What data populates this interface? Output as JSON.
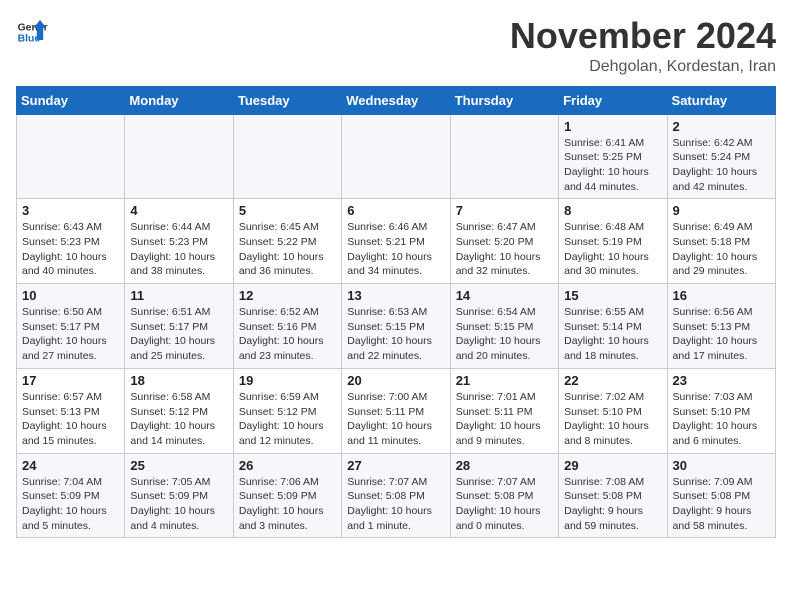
{
  "header": {
    "logo_line1": "General",
    "logo_line2": "Blue",
    "month": "November 2024",
    "location": "Dehgolan, Kordestan, Iran"
  },
  "weekdays": [
    "Sunday",
    "Monday",
    "Tuesday",
    "Wednesday",
    "Thursday",
    "Friday",
    "Saturday"
  ],
  "weeks": [
    [
      {
        "day": "",
        "info": ""
      },
      {
        "day": "",
        "info": ""
      },
      {
        "day": "",
        "info": ""
      },
      {
        "day": "",
        "info": ""
      },
      {
        "day": "",
        "info": ""
      },
      {
        "day": "1",
        "info": "Sunrise: 6:41 AM\nSunset: 5:25 PM\nDaylight: 10 hours and 44 minutes."
      },
      {
        "day": "2",
        "info": "Sunrise: 6:42 AM\nSunset: 5:24 PM\nDaylight: 10 hours and 42 minutes."
      }
    ],
    [
      {
        "day": "3",
        "info": "Sunrise: 6:43 AM\nSunset: 5:23 PM\nDaylight: 10 hours and 40 minutes."
      },
      {
        "day": "4",
        "info": "Sunrise: 6:44 AM\nSunset: 5:23 PM\nDaylight: 10 hours and 38 minutes."
      },
      {
        "day": "5",
        "info": "Sunrise: 6:45 AM\nSunset: 5:22 PM\nDaylight: 10 hours and 36 minutes."
      },
      {
        "day": "6",
        "info": "Sunrise: 6:46 AM\nSunset: 5:21 PM\nDaylight: 10 hours and 34 minutes."
      },
      {
        "day": "7",
        "info": "Sunrise: 6:47 AM\nSunset: 5:20 PM\nDaylight: 10 hours and 32 minutes."
      },
      {
        "day": "8",
        "info": "Sunrise: 6:48 AM\nSunset: 5:19 PM\nDaylight: 10 hours and 30 minutes."
      },
      {
        "day": "9",
        "info": "Sunrise: 6:49 AM\nSunset: 5:18 PM\nDaylight: 10 hours and 29 minutes."
      }
    ],
    [
      {
        "day": "10",
        "info": "Sunrise: 6:50 AM\nSunset: 5:17 PM\nDaylight: 10 hours and 27 minutes."
      },
      {
        "day": "11",
        "info": "Sunrise: 6:51 AM\nSunset: 5:17 PM\nDaylight: 10 hours and 25 minutes."
      },
      {
        "day": "12",
        "info": "Sunrise: 6:52 AM\nSunset: 5:16 PM\nDaylight: 10 hours and 23 minutes."
      },
      {
        "day": "13",
        "info": "Sunrise: 6:53 AM\nSunset: 5:15 PM\nDaylight: 10 hours and 22 minutes."
      },
      {
        "day": "14",
        "info": "Sunrise: 6:54 AM\nSunset: 5:15 PM\nDaylight: 10 hours and 20 minutes."
      },
      {
        "day": "15",
        "info": "Sunrise: 6:55 AM\nSunset: 5:14 PM\nDaylight: 10 hours and 18 minutes."
      },
      {
        "day": "16",
        "info": "Sunrise: 6:56 AM\nSunset: 5:13 PM\nDaylight: 10 hours and 17 minutes."
      }
    ],
    [
      {
        "day": "17",
        "info": "Sunrise: 6:57 AM\nSunset: 5:13 PM\nDaylight: 10 hours and 15 minutes."
      },
      {
        "day": "18",
        "info": "Sunrise: 6:58 AM\nSunset: 5:12 PM\nDaylight: 10 hours and 14 minutes."
      },
      {
        "day": "19",
        "info": "Sunrise: 6:59 AM\nSunset: 5:12 PM\nDaylight: 10 hours and 12 minutes."
      },
      {
        "day": "20",
        "info": "Sunrise: 7:00 AM\nSunset: 5:11 PM\nDaylight: 10 hours and 11 minutes."
      },
      {
        "day": "21",
        "info": "Sunrise: 7:01 AM\nSunset: 5:11 PM\nDaylight: 10 hours and 9 minutes."
      },
      {
        "day": "22",
        "info": "Sunrise: 7:02 AM\nSunset: 5:10 PM\nDaylight: 10 hours and 8 minutes."
      },
      {
        "day": "23",
        "info": "Sunrise: 7:03 AM\nSunset: 5:10 PM\nDaylight: 10 hours and 6 minutes."
      }
    ],
    [
      {
        "day": "24",
        "info": "Sunrise: 7:04 AM\nSunset: 5:09 PM\nDaylight: 10 hours and 5 minutes."
      },
      {
        "day": "25",
        "info": "Sunrise: 7:05 AM\nSunset: 5:09 PM\nDaylight: 10 hours and 4 minutes."
      },
      {
        "day": "26",
        "info": "Sunrise: 7:06 AM\nSunset: 5:09 PM\nDaylight: 10 hours and 3 minutes."
      },
      {
        "day": "27",
        "info": "Sunrise: 7:07 AM\nSunset: 5:08 PM\nDaylight: 10 hours and 1 minute."
      },
      {
        "day": "28",
        "info": "Sunrise: 7:07 AM\nSunset: 5:08 PM\nDaylight: 10 hours and 0 minutes."
      },
      {
        "day": "29",
        "info": "Sunrise: 7:08 AM\nSunset: 5:08 PM\nDaylight: 9 hours and 59 minutes."
      },
      {
        "day": "30",
        "info": "Sunrise: 7:09 AM\nSunset: 5:08 PM\nDaylight: 9 hours and 58 minutes."
      }
    ]
  ]
}
